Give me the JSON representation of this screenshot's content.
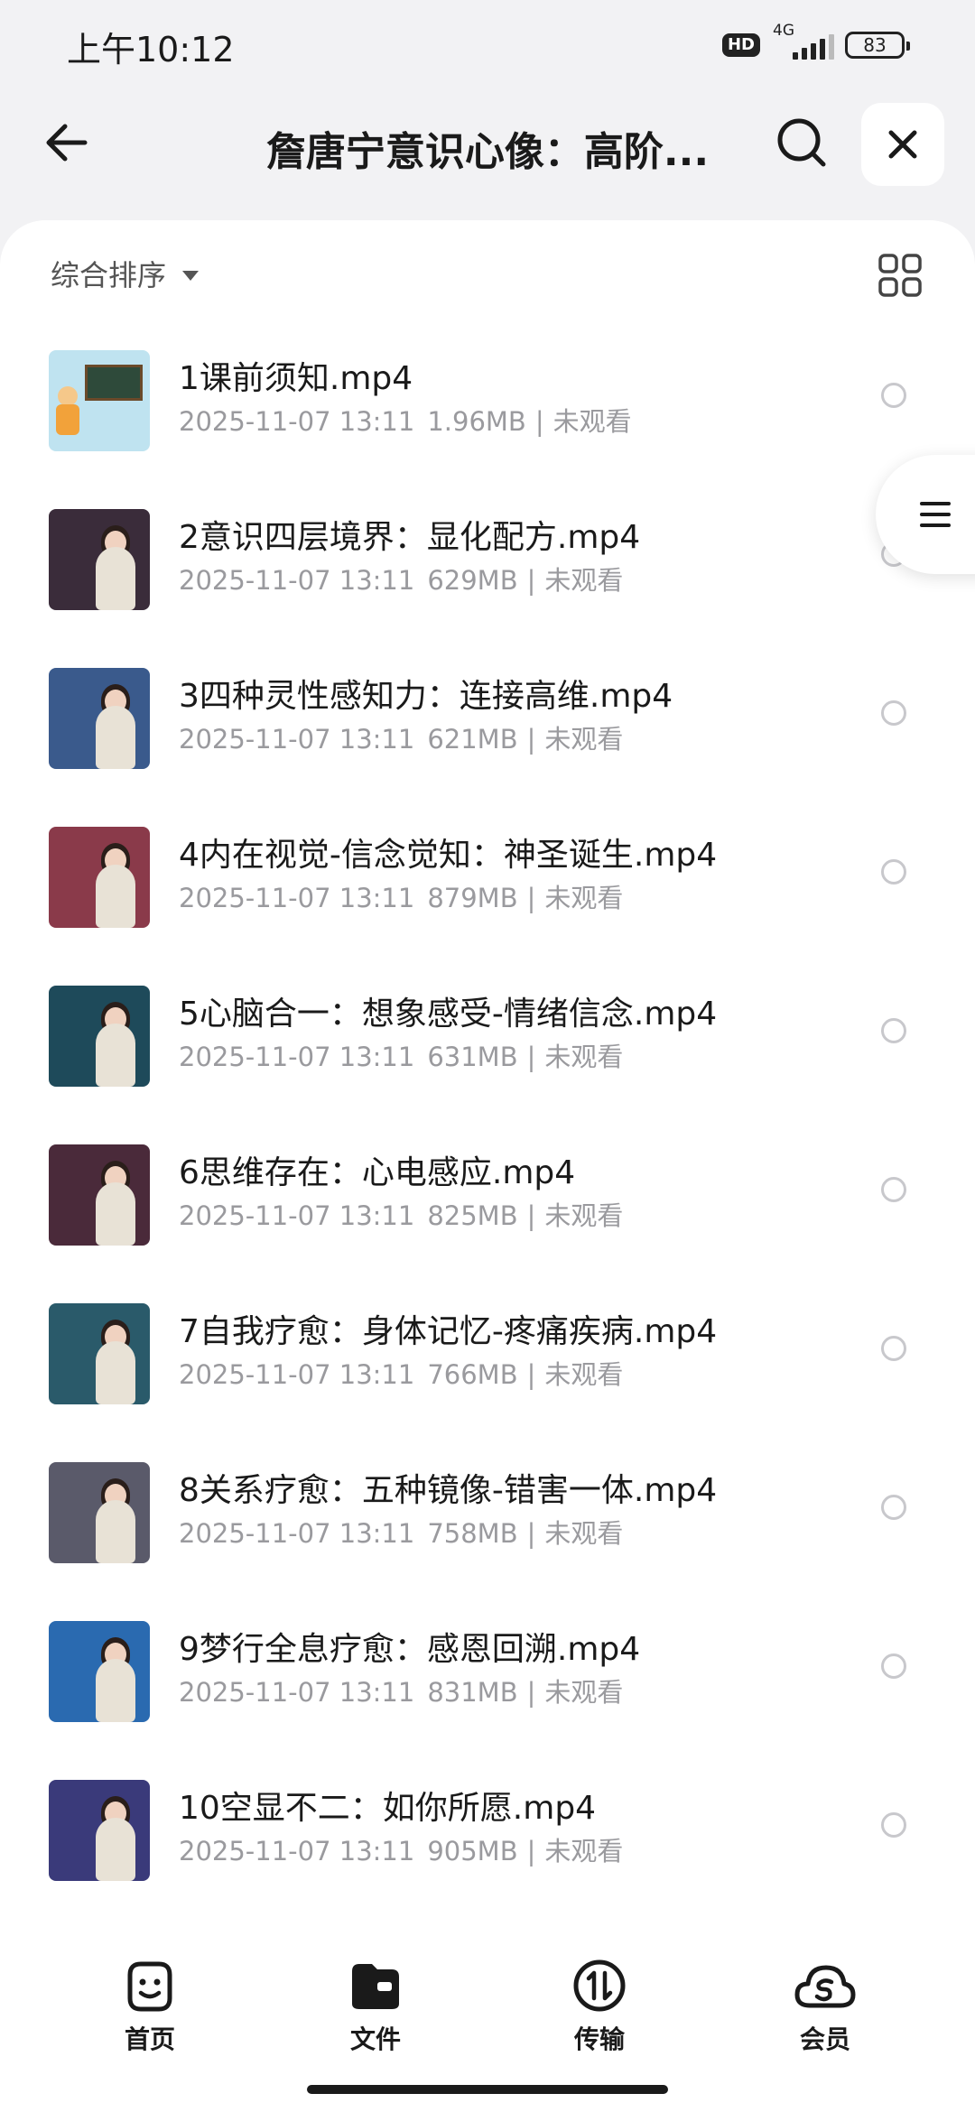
{
  "status_bar": {
    "time": "上午10:12",
    "hd": "HD",
    "network": "4G",
    "battery": "83"
  },
  "header": {
    "title": "詹唐宁意识心像：高阶...",
    "back_icon": "arrow-left-icon",
    "search_icon": "search-icon",
    "close_icon": "close-icon"
  },
  "toolbar": {
    "sort_label": "综合排序",
    "view_icon": "grid-view-icon"
  },
  "files": [
    {
      "name": "1课前须知.mp4",
      "date": "2025-11-07 13:11",
      "size": "1.96MB",
      "status": "未观看",
      "thumb_bg": "#bfe3f0"
    },
    {
      "name": "2意识四层境界：显化配方.mp4",
      "date": "2025-11-07 13:11",
      "size": "629MB",
      "status": "未观看",
      "thumb_bg": "#3a2c3a"
    },
    {
      "name": "3四种灵性感知力：连接高维.mp4",
      "date": "2025-11-07 13:11",
      "size": "621MB",
      "status": "未观看",
      "thumb_bg": "#3a5a8c"
    },
    {
      "name": "4内在视觉-信念觉知：神圣诞生.mp4",
      "date": "2025-11-07 13:11",
      "size": "879MB",
      "status": "未观看",
      "thumb_bg": "#8a3a4a"
    },
    {
      "name": "5心脑合一：想象感受-情绪信念.mp4",
      "date": "2025-11-07 13:11",
      "size": "631MB",
      "status": "未观看",
      "thumb_bg": "#1e4a5a"
    },
    {
      "name": "6思维存在：心电感应.mp4",
      "date": "2025-11-07 13:11",
      "size": "825MB",
      "status": "未观看",
      "thumb_bg": "#4a2a3a"
    },
    {
      "name": "7自我疗愈：身体记忆-疼痛疾病.mp4",
      "date": "2025-11-07 13:11",
      "size": "766MB",
      "status": "未观看",
      "thumb_bg": "#2a5a6a"
    },
    {
      "name": "8关系疗愈：五种镜像-错害一体.mp4",
      "date": "2025-11-07 13:11",
      "size": "758MB",
      "status": "未观看",
      "thumb_bg": "#5a5a6a"
    },
    {
      "name": "9梦行全息疗愈：感恩回溯.mp4",
      "date": "2025-11-07 13:11",
      "size": "831MB",
      "status": "未观看",
      "thumb_bg": "#2a6ab0"
    },
    {
      "name": "10空显不二：如你所愿.mp4",
      "date": "2025-11-07 13:11",
      "size": "905MB",
      "status": "未观看",
      "thumb_bg": "#3a3a7a"
    }
  ],
  "float_menu": {
    "icon": "menu-icon"
  },
  "nav": [
    {
      "label": "首页",
      "icon": "smile-home-icon"
    },
    {
      "label": "文件",
      "icon": "folder-icon"
    },
    {
      "label": "传输",
      "icon": "transfer-icon"
    },
    {
      "label": "会员",
      "icon": "cloud-member-icon"
    }
  ],
  "meta_separator": "|"
}
